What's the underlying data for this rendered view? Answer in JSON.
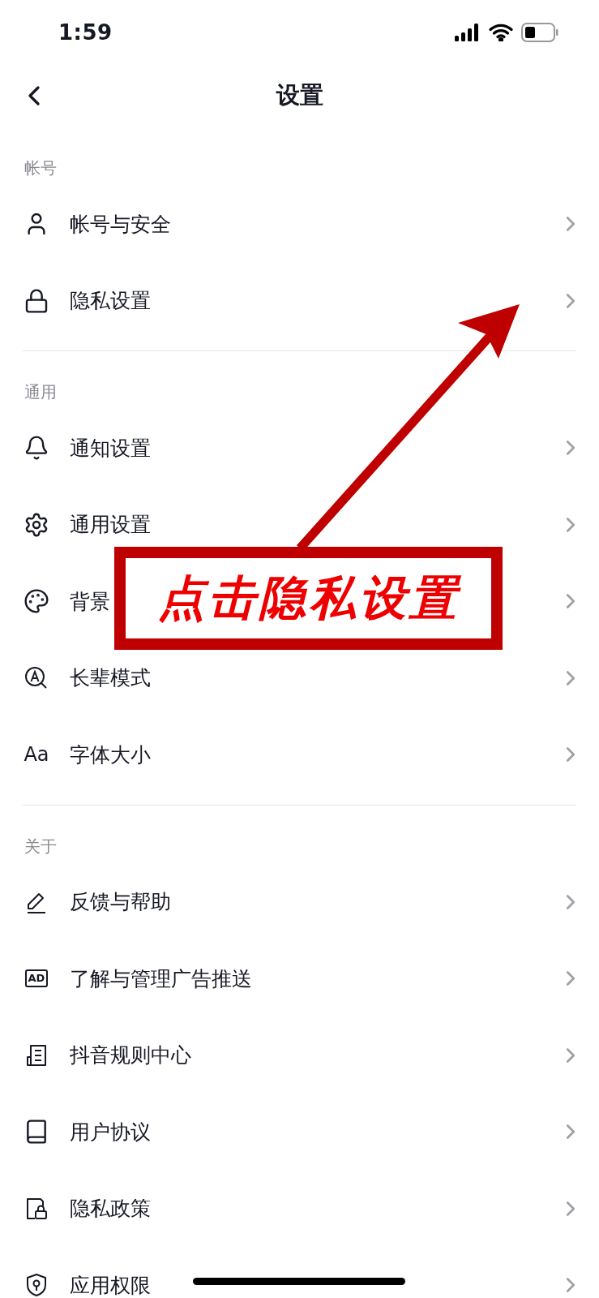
{
  "status_bar": {
    "time": "1:59"
  },
  "nav": {
    "title": "设置"
  },
  "sections": [
    {
      "header": "帐号",
      "items": [
        {
          "label": "帐号与安全",
          "kind": "user"
        },
        {
          "label": "隐私设置",
          "kind": "lock"
        }
      ]
    },
    {
      "header": "通用",
      "items": [
        {
          "label": "通知设置",
          "kind": "bell"
        },
        {
          "label": "通用设置",
          "kind": "gear"
        },
        {
          "label": "背景",
          "kind": "palette"
        },
        {
          "label": "长辈模式",
          "kind": "magnifier"
        },
        {
          "label": "字体大小",
          "kind": "glyph",
          "icon_text": "Aa"
        }
      ]
    },
    {
      "header": "关于",
      "items": [
        {
          "label": "反馈与帮助",
          "kind": "pencil"
        },
        {
          "label": "了解与管理广告推送",
          "kind": "tag",
          "icon_text": "AD"
        },
        {
          "label": "抖音规则中心",
          "kind": "document"
        },
        {
          "label": "用户协议",
          "kind": "book"
        },
        {
          "label": "隐私政策",
          "kind": "filelock"
        },
        {
          "label": "应用权限",
          "kind": "shield"
        }
      ]
    }
  ],
  "annotation": {
    "text": "点击隐私设置"
  }
}
